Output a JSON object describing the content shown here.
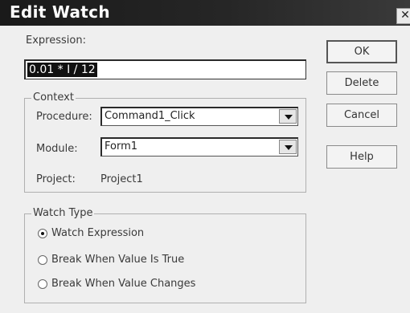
{
  "window": {
    "title": "Edit Watch",
    "close_glyph": "✕"
  },
  "expression": {
    "label": "Expression:",
    "value": "0.01 * I / 12"
  },
  "context": {
    "group_title": "Context",
    "procedure": {
      "label": "Procedure:",
      "value": "Command1_Click"
    },
    "module": {
      "label": "Module:",
      "value": "Form1"
    },
    "project": {
      "label": "Project:",
      "value": "Project1"
    }
  },
  "watch_type": {
    "group_title": "Watch Type",
    "options": [
      {
        "label": "Watch Expression",
        "selected": true
      },
      {
        "label": "Break When Value Is True",
        "selected": false
      },
      {
        "label": "Break When Value Changes",
        "selected": false
      }
    ]
  },
  "buttons": {
    "ok": "OK",
    "delete": "Delete",
    "cancel": "Cancel",
    "help": "Help"
  },
  "icons": [
    "close-icon",
    "dropdown-arrow-icon",
    "radio-selected-icon",
    "radio-unselected-icon"
  ]
}
